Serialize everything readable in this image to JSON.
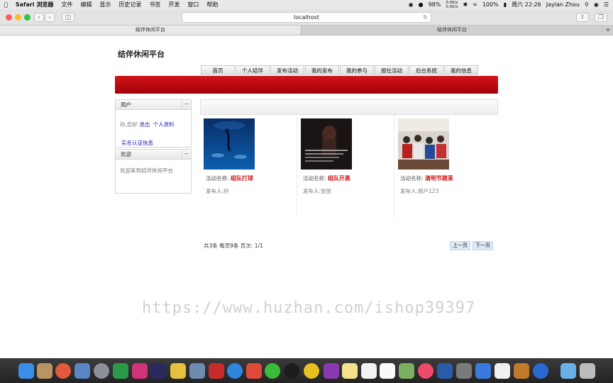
{
  "menubar": {
    "apple": "",
    "app_name": "Safari 浏览器",
    "menus": [
      "文件",
      "编辑",
      "显示",
      "历史记录",
      "书签",
      "开发",
      "窗口",
      "帮助"
    ],
    "status": {
      "battery_pct_left": "98%",
      "network_up": "0.0K/s",
      "network_down": "0.5K/s",
      "battery_pct": "100%",
      "datetime": "周六 22:26",
      "user": "Jaylan Zhou"
    }
  },
  "browser": {
    "address": "localhost",
    "tabs": [
      {
        "title": "结伴休闲平台",
        "active": true
      },
      {
        "title": "结伴休闲平台",
        "active": false
      }
    ],
    "new_tab": "+"
  },
  "site": {
    "title": "结伴休闲平台",
    "nav": [
      "首页",
      "个人结伴",
      "发布活动",
      "我的发布",
      "我的参与",
      "报社活动",
      "后台系统",
      "我的信息"
    ],
    "accent_color": "#c10a10"
  },
  "sidebar": {
    "user_panel": {
      "title": "用户",
      "toggle": "—",
      "greeting": "孙,您好",
      "logout": "退出",
      "profile": "个人资料",
      "verify": "实名认证信息"
    },
    "welcome_panel": {
      "title": "欢迎",
      "toggle": "—",
      "text": "欢迎来到结伴休闲平台"
    }
  },
  "activities": [
    {
      "label": "活动名称:",
      "name": "组队打球",
      "publisher": "发布人:孙"
    },
    {
      "label": "活动名称:",
      "name": "组队开黑",
      "publisher": "发布人:张张"
    },
    {
      "label": "活动名称:",
      "name": "清明节踏青",
      "publisher": "发布人:用户123"
    }
  ],
  "pager": {
    "info": "共3条 每页9条 页次: 1/1",
    "prev": "上一页",
    "next": "下一页"
  },
  "watermark": "https://www.huzhan.com/ishop39397"
}
